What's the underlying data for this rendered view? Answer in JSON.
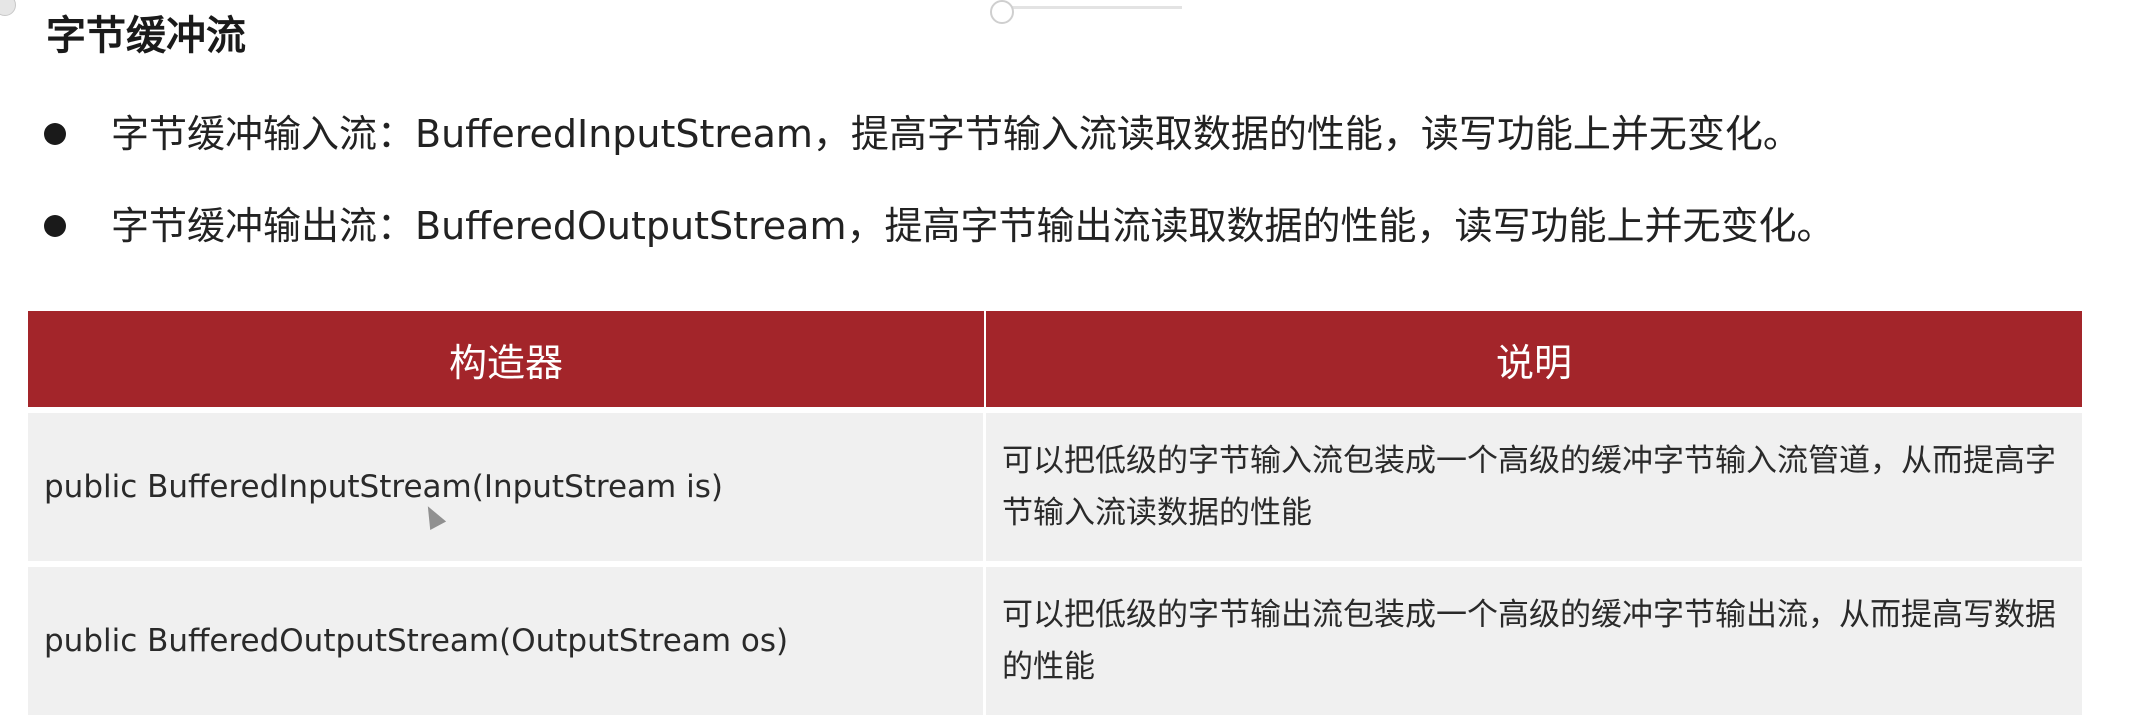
{
  "title": "字节缓冲流",
  "bullets": [
    "字节缓冲输入流：BufferedInputStream，提高字节输入流读取数据的性能，读写功能上并无变化。",
    "字节缓冲输出流：BufferedOutputStream，提高字节输出流读取数据的性能，读写功能上并无变化。"
  ],
  "table": {
    "headers": [
      "构造器",
      "说明"
    ],
    "rows": [
      {
        "constructor": "public BufferedInputStream(InputStream is)",
        "description": "可以把低级的字节输入流包装成一个高级的缓冲字节输入流管道，从而提高字节输入流读数据的性能"
      },
      {
        "constructor": "public BufferedOutputStream(OutputStream os)",
        "description": "可以把低级的字节输出流包装成一个高级的缓冲字节输出流，从而提高写数据的性能"
      }
    ]
  },
  "colors": {
    "header_bg": "#a3252a",
    "row_bg": "#f0f0f0"
  },
  "icons": [
    "close-icon",
    "slider-thumb",
    "bullet-dot-icon",
    "mouse-cursor-icon"
  ]
}
